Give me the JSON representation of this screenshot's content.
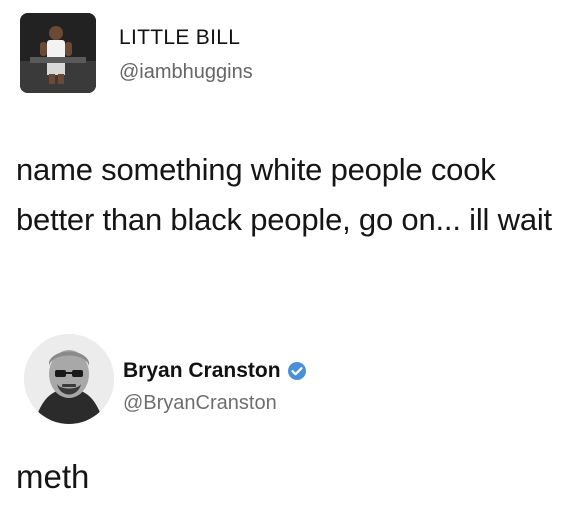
{
  "tweets": [
    {
      "display_name": "LITTLE BILL",
      "handle": "@iambhuggins",
      "text": "name something white people cook better than black people, go on... ill wait"
    },
    {
      "display_name": "Bryan Cranston",
      "handle": "@BryanCranston",
      "verified_icon": "verified-badge-icon",
      "text": "meth"
    }
  ],
  "colors": {
    "verified_badge": "#4a90d9",
    "handle_text": "#666666"
  }
}
